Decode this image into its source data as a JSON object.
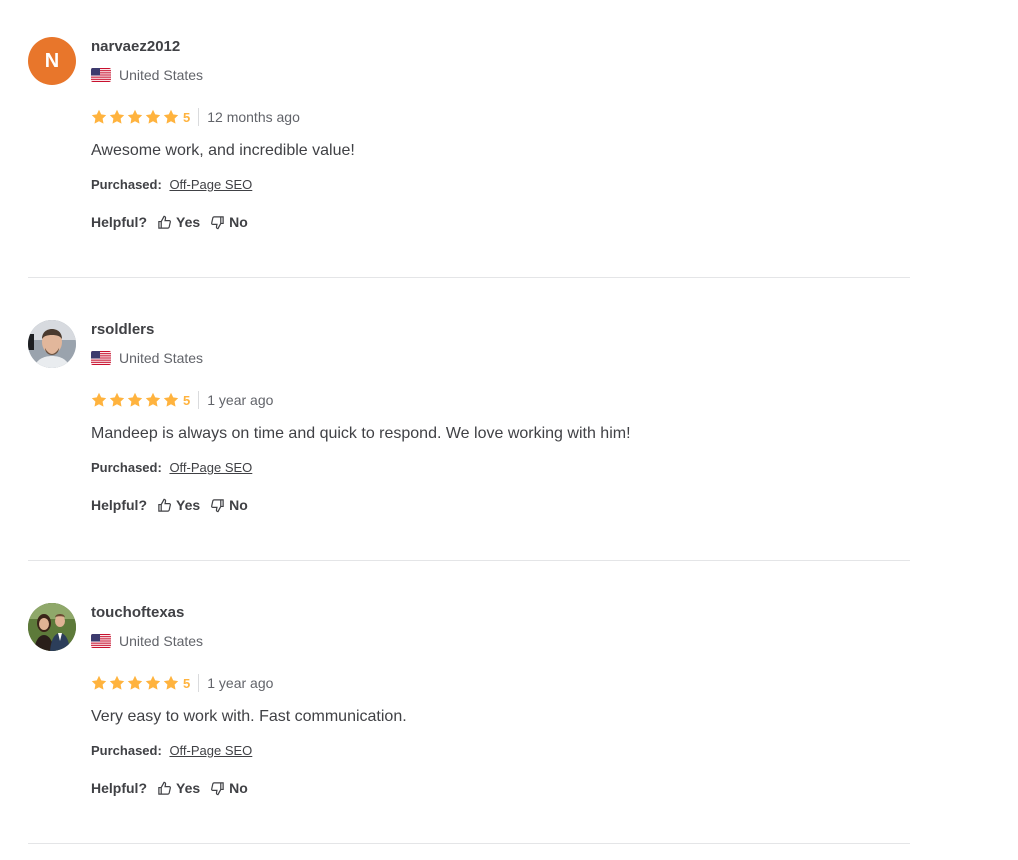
{
  "reviews": [
    {
      "username": "narvaez2012",
      "avatar_initial": "N",
      "avatar_color": "#e8762b",
      "country": "United States",
      "flag_icon": "us-flag-icon",
      "rating": "5",
      "rating_stars": 5,
      "time": "12 months ago",
      "text": "Awesome work, and incredible value!",
      "purchased_label": "Purchased:",
      "purchased_item": "Off-Page SEO",
      "helpful_label": "Helpful?",
      "yes_label": "Yes",
      "no_label": "No"
    },
    {
      "username": "rsoldlers",
      "avatar_initial": "",
      "avatar_color": "#8a8f96",
      "country": "United States",
      "flag_icon": "us-flag-icon",
      "rating": "5",
      "rating_stars": 5,
      "time": "1 year ago",
      "text": "Mandeep is always on time and quick to respond. We love working with him!",
      "purchased_label": "Purchased:",
      "purchased_item": "Off-Page SEO",
      "helpful_label": "Helpful?",
      "yes_label": "Yes",
      "no_label": "No"
    },
    {
      "username": "touchoftexas",
      "avatar_initial": "",
      "avatar_color": "#5b6b3e",
      "country": "United States",
      "flag_icon": "us-flag-icon",
      "rating": "5",
      "rating_stars": 5,
      "time": "1 year ago",
      "text": "Very easy to work with. Fast communication.",
      "purchased_label": "Purchased:",
      "purchased_item": "Off-Page SEO",
      "helpful_label": "Helpful?",
      "yes_label": "Yes",
      "no_label": "No"
    }
  ],
  "colors": {
    "star": "#ffb33e",
    "text": "#404145",
    "muted": "#62646a",
    "divider": "#e4e5e7"
  }
}
